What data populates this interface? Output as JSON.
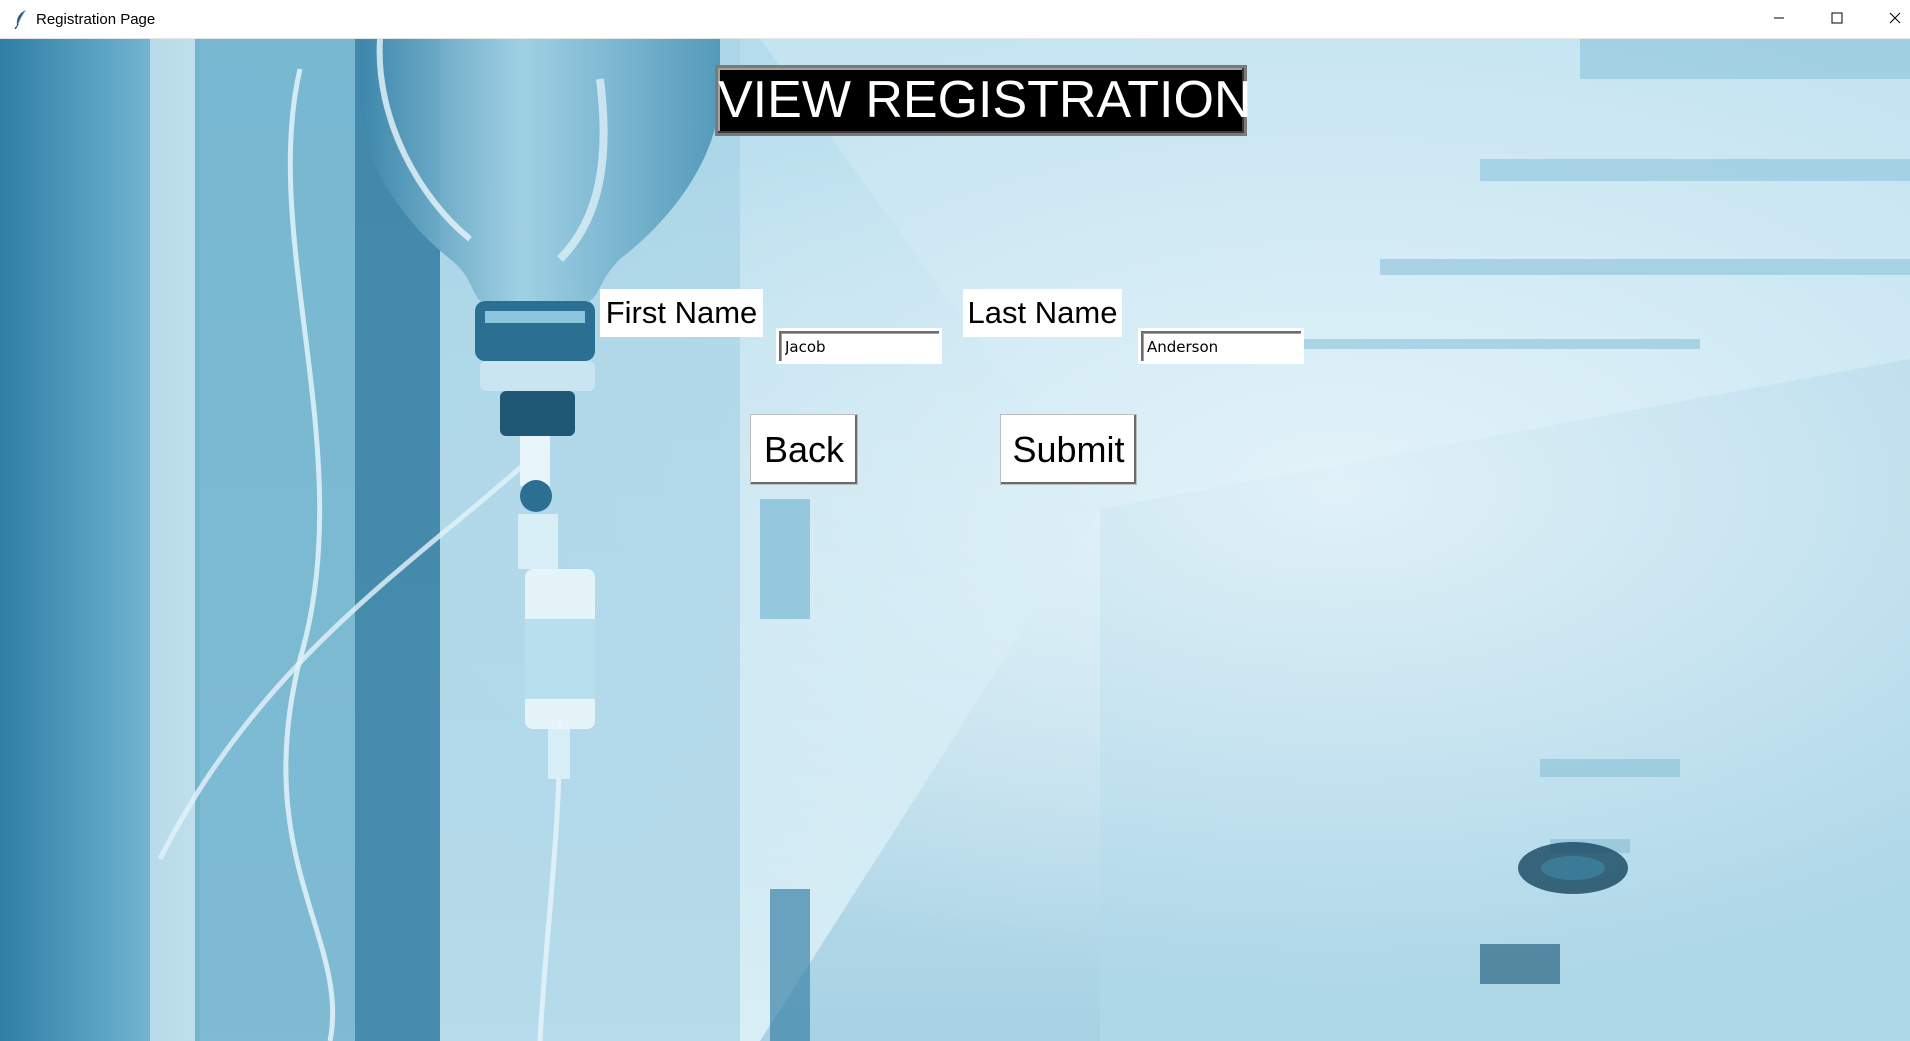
{
  "window": {
    "title": "Registration Page",
    "app_icon": "feather-icon",
    "controls": {
      "minimize_icon": "minimize-icon",
      "maximize_icon": "maximize-icon",
      "close_icon": "close-icon"
    }
  },
  "page": {
    "heading": "VIEW REGISTRATION",
    "background_image": "hospital-iv-drip-corridor",
    "accent_color": "#8cc8e0"
  },
  "form": {
    "first_name": {
      "label": "First Name",
      "value": "Jacob"
    },
    "last_name": {
      "label": "Last Name",
      "value": "Anderson"
    }
  },
  "buttons": {
    "back_label": "Back",
    "submit_label": "Submit"
  }
}
